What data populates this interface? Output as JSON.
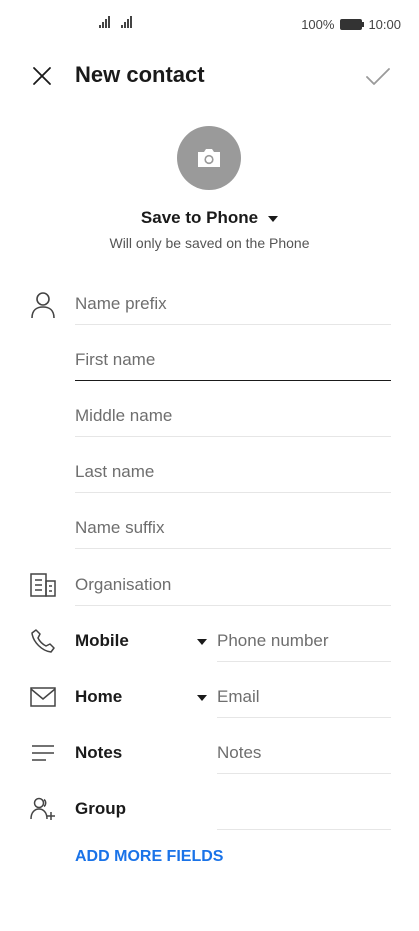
{
  "status_bar": {
    "battery_text": "100%",
    "time": "10:00"
  },
  "header": {
    "title": "New contact",
    "close_icon": "close-icon",
    "confirm_icon": "check-icon"
  },
  "photo": {
    "icon": "camera-icon",
    "background_color": "#9a9a9a"
  },
  "account": {
    "title": "Save to Phone",
    "subtitle": "Will only be saved on the Phone"
  },
  "name_fields": [
    {
      "placeholder": "Name prefix"
    },
    {
      "placeholder": "First name"
    },
    {
      "placeholder": "Middle name"
    },
    {
      "placeholder": "Last name"
    },
    {
      "placeholder": "Name suffix"
    }
  ],
  "organisation": {
    "placeholder": "Organisation"
  },
  "phone": {
    "type": "Mobile",
    "placeholder": "Phone number"
  },
  "email": {
    "type": "Home",
    "placeholder": "Email"
  },
  "notes": {
    "label": "Notes",
    "placeholder": "Notes"
  },
  "group": {
    "label": "Group",
    "value": ""
  },
  "add_more": {
    "label": "ADD MORE FIELDS",
    "color": "#1a73e8"
  }
}
